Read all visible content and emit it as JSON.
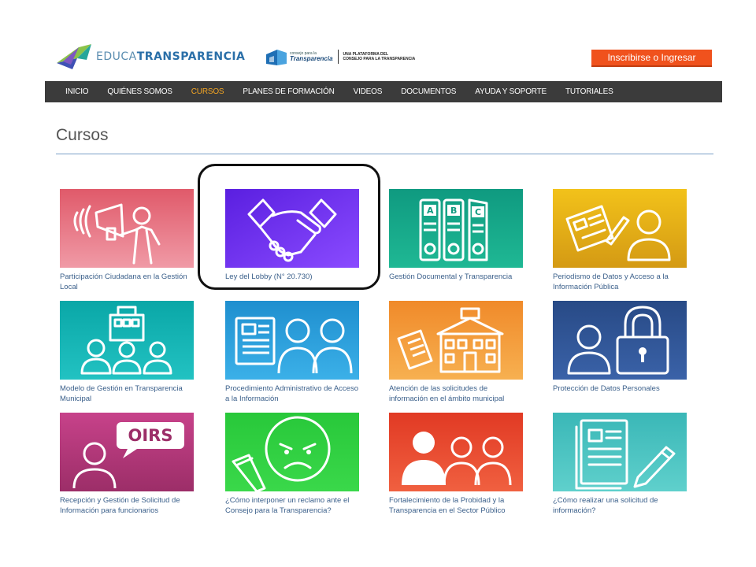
{
  "header": {
    "logo_part1": "EDUCA",
    "logo_part2": "TRANSPARENCIA",
    "cpt_small_top": "consejo para la",
    "cpt_small_name": "Transparencia",
    "cpt_tag_line1": "UNA PLATAFORMA DEL",
    "cpt_tag_line2": "CONSEJO PARA LA TRANSPARENCIA",
    "login_label": "Inscribirse o Ingresar"
  },
  "nav": {
    "items": [
      "INICIO",
      "QUIÉNES SOMOS",
      "CURSOS",
      "PLANES DE FORMACIÓN",
      "VIDEOS",
      "DOCUMENTOS",
      "AYUDA Y SOPORTE",
      "TUTORIALES"
    ],
    "active": "CURSOS"
  },
  "page": {
    "title": "Cursos"
  },
  "courses": [
    {
      "title": "Participación Ciudadana en la Gestión Local",
      "icon": "megaphone-person-icon",
      "color": "#e4717e"
    },
    {
      "title": "Ley del Lobby (N° 20.730)",
      "icon": "handshake-icon",
      "color": "#6a2bf0"
    },
    {
      "title": "Gestión Documental y Transparencia",
      "icon": "binders-icon",
      "color": "#16a085"
    },
    {
      "title": "Periodismo de Datos y Acceso a la Información Pública",
      "icon": "newspaper-person-icon",
      "color": "#e9b81c"
    },
    {
      "title": "Modelo de Gestión en Transparencia Municipal",
      "icon": "municipality-people-icon",
      "color": "#16b4b4"
    },
    {
      "title": "Procedimiento Administrativo de Acceso a la Información",
      "icon": "document-people-icon",
      "color": "#2a9fd6"
    },
    {
      "title": "Atención de las solicitudes de información en el ámbito municipal",
      "icon": "newspaper-building-icon",
      "color": "#f39c3a"
    },
    {
      "title": "Protección de Datos Personales",
      "icon": "padlock-person-icon",
      "color": "#2c4f8c"
    },
    {
      "title": "Recepción y Gestión de Solicitud de Información para funcionarios",
      "icon": "oirs-person-icon",
      "color": "#b23a7a",
      "badge": "OIRS"
    },
    {
      "title": "¿Cómo interponer un reclamo ante el Consejo para la Transparencia?",
      "icon": "angry-face-pencil-icon",
      "color": "#2ecc40"
    },
    {
      "title": "Fortalecimiento de la Probidad y la Transparencia en el Sector Público",
      "icon": "three-people-icon",
      "color": "#e8452c"
    },
    {
      "title": "¿Cómo realizar una solicitud de información?",
      "icon": "document-pencil-icon",
      "color": "#3cc3c3"
    }
  ]
}
